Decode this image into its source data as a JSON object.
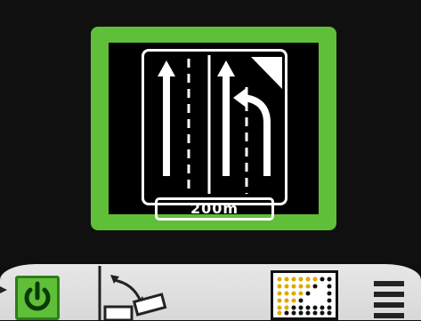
{
  "sign": {
    "distance": "200m"
  },
  "toolbar": {
    "buttons": [
      {
        "name": "power",
        "icon": "power-icon"
      },
      {
        "name": "lane-change",
        "icon": "lane-change-icon"
      },
      {
        "name": "pattern",
        "icon": "arrow-board-pattern-icon"
      },
      {
        "name": "menu",
        "icon": "menu-icon"
      }
    ]
  },
  "colors": {
    "accent": "#5fbf39",
    "background": "#101010",
    "toolbar": "#e0e0e0"
  }
}
